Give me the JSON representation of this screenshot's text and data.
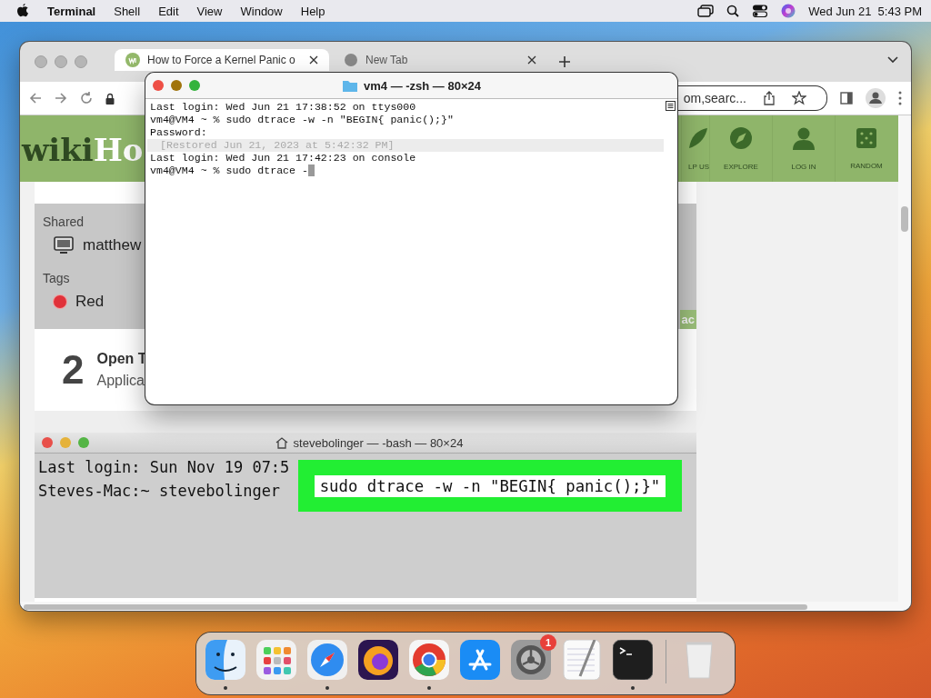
{
  "menu_bar": {
    "app": "Terminal",
    "menus": [
      "Shell",
      "Edit",
      "View",
      "Window",
      "Help"
    ],
    "clock": "Wed Jun 21  5:43 PM"
  },
  "browser": {
    "tabs": [
      {
        "title": "How to Force a Kernel Panic o",
        "selected": true
      },
      {
        "title": "New Tab",
        "selected": false
      }
    ],
    "address": "om,searc...",
    "site": {
      "logo": [
        "wiki",
        "Ho"
      ],
      "nav": [
        "LP US",
        "EXPLORE",
        "LOG IN",
        "RANDOM"
      ],
      "finder_sidebar": [
        {
          "heading": "Shared",
          "items": [
            {
              "label": "matthew",
              "kind": "computer"
            }
          ]
        },
        {
          "heading": "Tags",
          "items": [
            {
              "label": "Red",
              "kind": "tag",
              "color": "#e0323a"
            }
          ]
        }
      ],
      "badge": "ac",
      "step": {
        "number": "2",
        "title": "Open T",
        "subtitle": "Applica"
      },
      "terminal_image": {
        "title": "stevebolinger — -bash — 80×24",
        "lines": [
          "Last login: Sun Nov 19 07:5",
          "Steves-Mac:~ stevebolinger"
        ],
        "highlight": "sudo dtrace -w -n \"BEGIN{ panic();}\""
      }
    }
  },
  "terminal": {
    "title": "vm4 — -zsh — 80×24",
    "lines": [
      {
        "text": "Last login: Wed Jun 21 17:38:52 on ttys000",
        "kind": "output",
        "cursor": false
      },
      {
        "text": "vm4@VM4 ~ % sudo dtrace -w -n \"BEGIN{ panic();}\"",
        "kind": "output",
        "cursor": false
      },
      {
        "text": "Password:",
        "kind": "output",
        "cursor": false
      },
      {
        "text": "[Restored Jun 21, 2023 at 5:42:32 PM]",
        "kind": "restored",
        "cursor": false
      },
      {
        "text": "Last login: Wed Jun 21 17:42:23 on console",
        "kind": "output",
        "cursor": false
      },
      {
        "text": "vm4@VM4 ~ % sudo dtrace -",
        "kind": "output",
        "cursor": true
      }
    ]
  },
  "dock": {
    "apps": [
      {
        "kind": "finder",
        "running": true
      },
      {
        "kind": "launchpad",
        "running": false
      },
      {
        "kind": "safari",
        "running": true
      },
      {
        "kind": "firefox",
        "running": false
      },
      {
        "kind": "chrome",
        "running": true
      },
      {
        "kind": "appstore",
        "running": false
      },
      {
        "kind": "settings",
        "running": false,
        "badge": "1"
      },
      {
        "kind": "textedit",
        "running": false
      },
      {
        "kind": "terminal",
        "running": true
      },
      {
        "kind": "trash",
        "running": false
      }
    ]
  }
}
